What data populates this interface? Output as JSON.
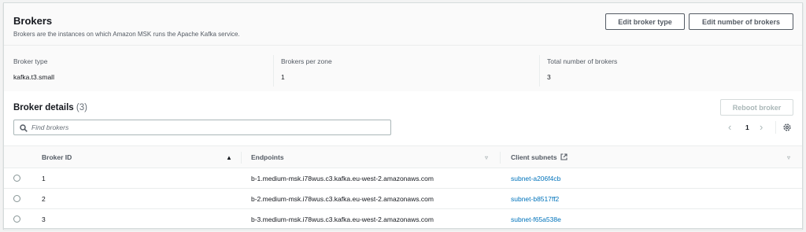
{
  "header": {
    "title": "Brokers",
    "description": "Brokers are the instances on which Amazon MSK runs the Apache Kafka service.",
    "edit_type_label": "Edit broker type",
    "edit_number_label": "Edit number of brokers"
  },
  "summary": [
    {
      "label": "Broker type",
      "value": "kafka.t3.small"
    },
    {
      "label": "Brokers per zone",
      "value": "1"
    },
    {
      "label": "Total number of brokers",
      "value": "3"
    }
  ],
  "details": {
    "title": "Broker details",
    "count": "(3)",
    "reboot_label": "Reboot broker",
    "search_placeholder": "Find brokers",
    "page": "1"
  },
  "table": {
    "columns": [
      "Broker ID",
      "Endpoints",
      "Client subnets"
    ],
    "rows": [
      {
        "id": "1",
        "endpoint": "b-1.medium-msk.i78wus.c3.kafka.eu-west-2.amazonaws.com",
        "subnet": "subnet-a206f4cb"
      },
      {
        "id": "2",
        "endpoint": "b-2.medium-msk.i78wus.c3.kafka.eu-west-2.amazonaws.com",
        "subnet": "subnet-b8517ff2"
      },
      {
        "id": "3",
        "endpoint": "b-3.medium-msk.i78wus.c3.kafka.eu-west-2.amazonaws.com",
        "subnet": "subnet-f65a538e"
      }
    ]
  },
  "colors": {
    "link": "#0073bb",
    "text": "#16191f",
    "muted": "#545b64"
  }
}
